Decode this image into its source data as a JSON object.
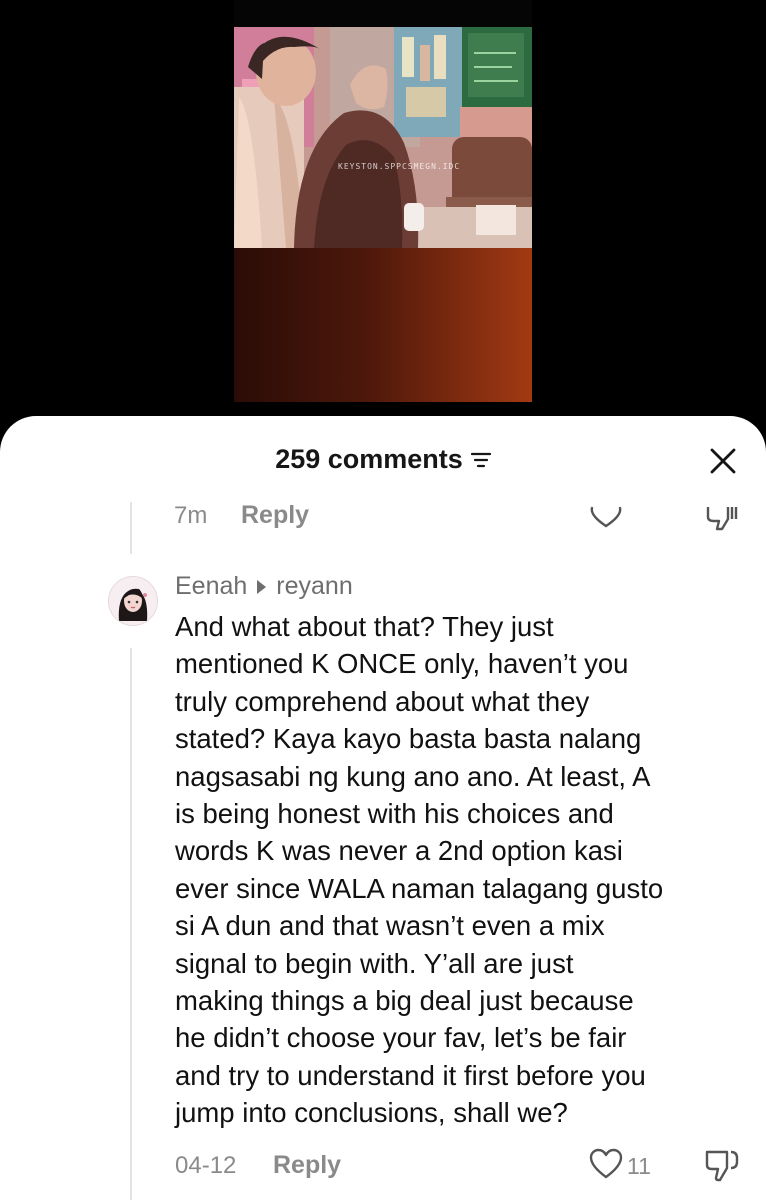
{
  "video": {
    "watermark": "KEYSTON.SPPCSMEGN.IDC"
  },
  "header": {
    "title": "259 comments",
    "filter_icon": "filter-icon",
    "close_icon": "close-icon"
  },
  "prev_comment": {
    "time": "7m",
    "reply_label": "Reply"
  },
  "comment": {
    "username": "Eenah",
    "reply_to": "reyann",
    "lines": [
      "And what about that? They just",
      "mentioned K ONCE only, haven’t you",
      "truly comprehend about what they",
      "stated? Kaya kayo basta basta nalang",
      "nagsasabi ng kung ano ano. At least, A",
      "is being honest with his choices and",
      "words K was never a 2nd option kasi",
      "ever since WALA naman talagang gusto",
      "si A dun and that wasn’t even a mix",
      "signal to begin with. Y’all are just",
      "making things a big deal just because",
      "he didn’t choose your fav, let’s be fair",
      "and try to understand it first before you",
      "jump into conclusions, shall we?"
    ],
    "date": "04-12",
    "reply_label": "Reply",
    "likes": "11"
  }
}
